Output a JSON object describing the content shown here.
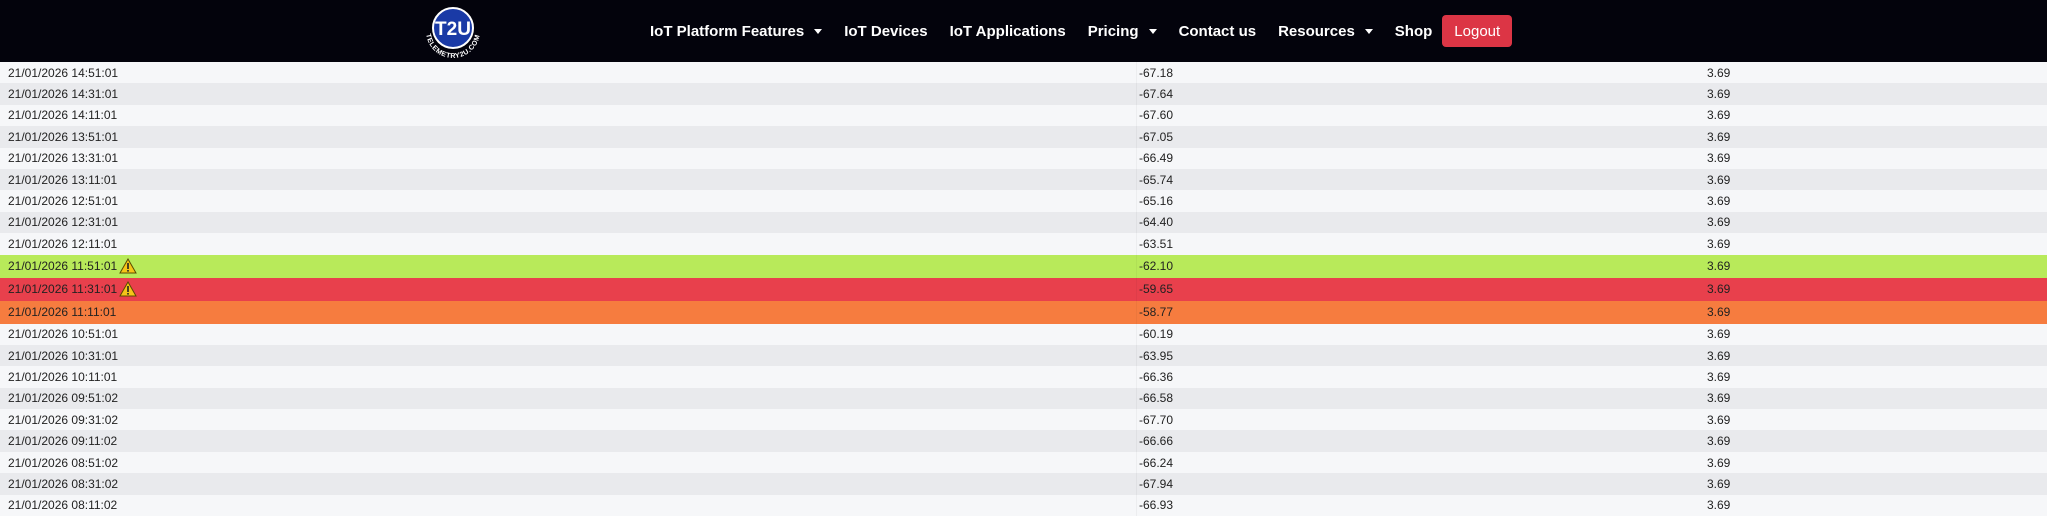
{
  "nav": {
    "logo_text": "T2U",
    "logo_ring_text": "TELEMETRY2U.COM",
    "items": [
      {
        "label": "IoT Platform Features",
        "dropdown": true
      },
      {
        "label": "IoT Devices",
        "dropdown": false
      },
      {
        "label": "IoT Applications",
        "dropdown": false
      },
      {
        "label": "Pricing",
        "dropdown": true
      },
      {
        "label": "Contact us",
        "dropdown": false
      },
      {
        "label": "Resources",
        "dropdown": true
      },
      {
        "label": "Shop",
        "dropdown": false
      }
    ],
    "logout_label": "Logout"
  },
  "colors": {
    "navbar_bg": "#03030c",
    "logout_bg": "#dc3545",
    "alert_green": "#b8ea5a",
    "alert_red": "#e8404c",
    "alert_orange": "#f67c3f",
    "row_light": "#f6f7f9",
    "row_dark": "#e9eaed",
    "logo_blue": "#1a3aa6"
  },
  "rows": [
    {
      "time": "21/01/2026 14:51:01",
      "value": "-67.18",
      "battery": "3.69",
      "status": "normal",
      "warning": false
    },
    {
      "time": "21/01/2026 14:31:01",
      "value": "-67.64",
      "battery": "3.69",
      "status": "normal",
      "warning": false
    },
    {
      "time": "21/01/2026 14:11:01",
      "value": "-67.60",
      "battery": "3.69",
      "status": "normal",
      "warning": false
    },
    {
      "time": "21/01/2026 13:51:01",
      "value": "-67.05",
      "battery": "3.69",
      "status": "normal",
      "warning": false
    },
    {
      "time": "21/01/2026 13:31:01",
      "value": "-66.49",
      "battery": "3.69",
      "status": "normal",
      "warning": false
    },
    {
      "time": "21/01/2026 13:11:01",
      "value": "-65.74",
      "battery": "3.69",
      "status": "normal",
      "warning": false
    },
    {
      "time": "21/01/2026 12:51:01",
      "value": "-65.16",
      "battery": "3.69",
      "status": "normal",
      "warning": false
    },
    {
      "time": "21/01/2026 12:31:01",
      "value": "-64.40",
      "battery": "3.69",
      "status": "normal",
      "warning": false
    },
    {
      "time": "21/01/2026 12:11:01",
      "value": "-63.51",
      "battery": "3.69",
      "status": "normal",
      "warning": false
    },
    {
      "time": "21/01/2026 11:51:01",
      "value": "-62.10",
      "battery": "3.69",
      "status": "green",
      "warning": true
    },
    {
      "time": "21/01/2026 11:31:01",
      "value": "-59.65",
      "battery": "3.69",
      "status": "red",
      "warning": true
    },
    {
      "time": "21/01/2026 11:11:01",
      "value": "-58.77",
      "battery": "3.69",
      "status": "orange",
      "warning": false
    },
    {
      "time": "21/01/2026 10:51:01",
      "value": "-60.19",
      "battery": "3.69",
      "status": "normal",
      "warning": false
    },
    {
      "time": "21/01/2026 10:31:01",
      "value": "-63.95",
      "battery": "3.69",
      "status": "normal",
      "warning": false
    },
    {
      "time": "21/01/2026 10:11:01",
      "value": "-66.36",
      "battery": "3.69",
      "status": "normal",
      "warning": false
    },
    {
      "time": "21/01/2026 09:51:02",
      "value": "-66.58",
      "battery": "3.69",
      "status": "normal",
      "warning": false
    },
    {
      "time": "21/01/2026 09:31:02",
      "value": "-67.70",
      "battery": "3.69",
      "status": "normal",
      "warning": false
    },
    {
      "time": "21/01/2026 09:11:02",
      "value": "-66.66",
      "battery": "3.69",
      "status": "normal",
      "warning": false
    },
    {
      "time": "21/01/2026 08:51:02",
      "value": "-66.24",
      "battery": "3.69",
      "status": "normal",
      "warning": false
    },
    {
      "time": "21/01/2026 08:31:02",
      "value": "-67.94",
      "battery": "3.69",
      "status": "normal",
      "warning": false
    },
    {
      "time": "21/01/2026 08:11:02",
      "value": "-66.93",
      "battery": "3.69",
      "status": "normal",
      "warning": false
    }
  ]
}
